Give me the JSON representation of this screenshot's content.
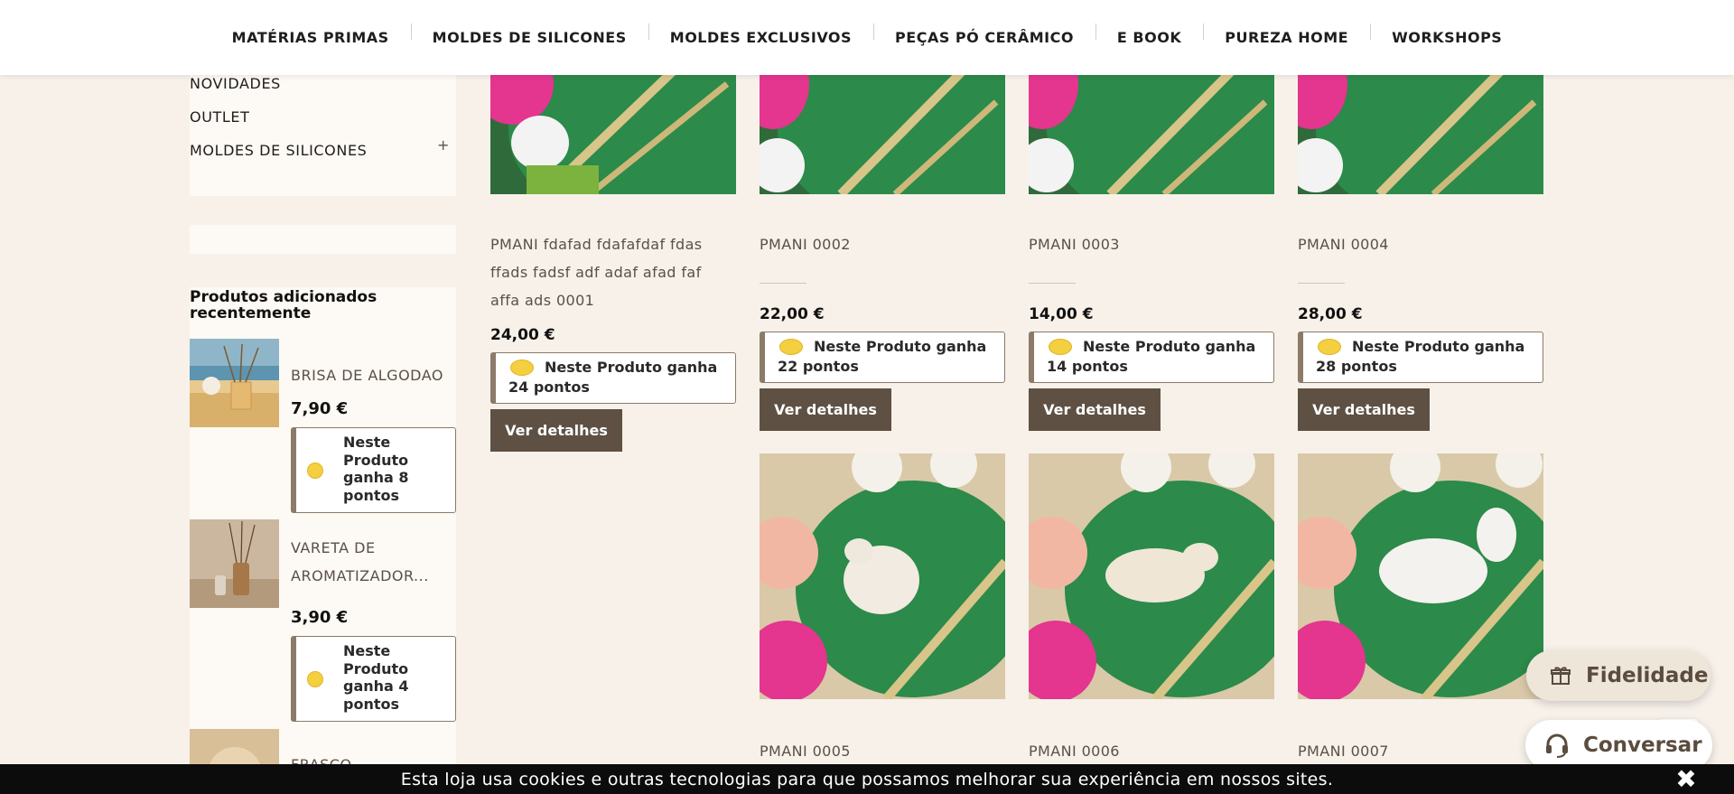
{
  "nav": {
    "items": [
      "MATÉRIAS PRIMAS",
      "MOLDES DE SILICONES",
      "MOLDES EXCLUSIVOS",
      "PEÇAS PÓ CERÂMICO",
      "E BOOK",
      "PUREZA HOME",
      "WORKSHOPS"
    ]
  },
  "sidebar": {
    "links": [
      "NOVIDADES",
      "OUTLET",
      "MOLDES DE SILICONES"
    ],
    "expand_symbol": "+",
    "recent": {
      "title": "Produtos adicionados recentemente",
      "items": [
        {
          "name": "BRISA DE ALGODAO",
          "price": "7,90 €",
          "points": "Neste Produto ganha 8 pontos"
        },
        {
          "name": "VARETA DE AROMATIZADOR...",
          "name_line1": "VARETA DE",
          "name_line2": "AROMATIZADOR...",
          "price": "3,90 €",
          "points": "Neste Produto ganha 4 pontos"
        },
        {
          "name": "FRASCO"
        }
      ]
    }
  },
  "products": [
    {
      "name": "PMANI fdafad fdafafdaf fdas ffads fadsf adf adaf afad faf affa ads 0001",
      "price": "24,00 €",
      "points": "Neste Produto ganha 24 pontos",
      "button": "Ver detalhes"
    },
    {
      "name": "PMANI 0002",
      "price": "22,00 €",
      "points": "Neste Produto ganha 22 pontos",
      "button": "Ver detalhes"
    },
    {
      "name": "PMANI 0003",
      "price": "14,00 €",
      "points": "Neste Produto ganha 14 pontos",
      "button": "Ver detalhes"
    },
    {
      "name": "PMANI 0004",
      "price": "28,00 €",
      "points": "Neste Produto ganha 28 pontos",
      "button": "Ver detalhes"
    },
    {
      "name": "PMANI 0005"
    },
    {
      "name": "PMANI 0006"
    },
    {
      "name": "PMANI 0007"
    }
  ],
  "widgets": {
    "loyalty": "Fidelidade",
    "chat": "Conversar"
  },
  "cookie": {
    "text": "Esta loja usa cookies e outras tecnologias para que possamos melhorar sua experiência em nossos sites.",
    "close": "✖"
  },
  "colors": {
    "page_bg": "#f7f1ea",
    "panel_bg": "#fdf9f4",
    "button_bg": "#5e5143",
    "coin": "#f4cf3f",
    "border_accent": "#8b7b68"
  }
}
